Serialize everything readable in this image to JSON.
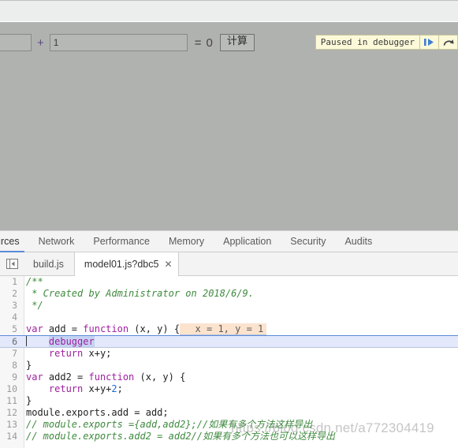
{
  "page": {
    "calculator": {
      "input_a_value": "",
      "input_b_value": "1",
      "plus_label": "+",
      "equals_label": "=",
      "result_value": "0",
      "calc_button_label": "计算"
    },
    "debugger_banner": {
      "message": "Paused in debugger",
      "resume_icon": "resume-script-execution-icon",
      "step_over_icon": "step-over-next-function-call-icon"
    }
  },
  "devtools": {
    "panel_tabs": [
      {
        "label": "urces",
        "active": true
      },
      {
        "label": "Network",
        "active": false
      },
      {
        "label": "Performance",
        "active": false
      },
      {
        "label": "Memory",
        "active": false
      },
      {
        "label": "Application",
        "active": false
      },
      {
        "label": "Security",
        "active": false
      },
      {
        "label": "Audits",
        "active": false
      }
    ],
    "navigator_toggle_icon": "show-navigator-panel-icon",
    "file_tabs": [
      {
        "label": "build.js",
        "active": false,
        "closable": false
      },
      {
        "label": "model01.js?dbc5",
        "active": true,
        "closable": true,
        "close_label": "✕"
      }
    ],
    "editor": {
      "inline_value_hint": "x = 1, y = 1",
      "lines": [
        {
          "n": "1",
          "tokens": [
            {
              "t": "/**",
              "c": "cmt"
            }
          ]
        },
        {
          "n": "2",
          "tokens": [
            {
              "t": " * Created by Administrator on 2018/6/9.",
              "c": "cmt"
            }
          ]
        },
        {
          "n": "3",
          "tokens": [
            {
              "t": " */",
              "c": "cmt"
            }
          ]
        },
        {
          "n": "4",
          "tokens": []
        },
        {
          "n": "5",
          "tokens": [
            {
              "t": "var",
              "c": "kw"
            },
            {
              "t": " add = ",
              "c": "op"
            },
            {
              "t": "function",
              "c": "kw"
            },
            {
              "t": " (x, y) {",
              "c": "op"
            }
          ],
          "hint": true
        },
        {
          "n": "6",
          "tokens": [
            {
              "t": "    ",
              "c": "op"
            },
            {
              "t": "debugger",
              "c": "kw",
              "sel": true
            }
          ],
          "exec": true,
          "caret": true
        },
        {
          "n": "7",
          "tokens": [
            {
              "t": "    ",
              "c": "op"
            },
            {
              "t": "return",
              "c": "kw"
            },
            {
              "t": " x+y;",
              "c": "op"
            }
          ]
        },
        {
          "n": "8",
          "tokens": [
            {
              "t": "}",
              "c": "op"
            }
          ]
        },
        {
          "n": "9",
          "tokens": [
            {
              "t": "var",
              "c": "kw"
            },
            {
              "t": " add2 = ",
              "c": "op"
            },
            {
              "t": "function",
              "c": "kw"
            },
            {
              "t": " (x, y) {",
              "c": "op"
            }
          ]
        },
        {
          "n": "10",
          "tokens": [
            {
              "t": "    ",
              "c": "op"
            },
            {
              "t": "return",
              "c": "kw"
            },
            {
              "t": " x+y+",
              "c": "op"
            },
            {
              "t": "2",
              "c": "num"
            },
            {
              "t": ";",
              "c": "op"
            }
          ]
        },
        {
          "n": "11",
          "tokens": [
            {
              "t": "}",
              "c": "op"
            }
          ]
        },
        {
          "n": "12",
          "tokens": [
            {
              "t": "module.exports.add = add;",
              "c": "op"
            }
          ]
        },
        {
          "n": "13",
          "tokens": [
            {
              "t": "// module.exports ={add,add2};//如果有多个方法这样导出",
              "c": "cmt"
            }
          ]
        },
        {
          "n": "14",
          "tokens": [
            {
              "t": "// module.exports.add2 = add2//如果有多个方法也可以这样导出",
              "c": "cmt"
            }
          ]
        }
      ]
    }
  },
  "watermark": {
    "text": "https://blog.csdn.net/a772304419"
  },
  "colors": {
    "accent_blue": "#5b8bd9",
    "exec_line_bg": "#e3e8fb",
    "value_hint_bg": "#fbe3ce",
    "paused_banner_bg": "#fcf9d9",
    "page_overlay_grey": "#b0b2b0",
    "comment_green": "#3f8a3f",
    "keyword_purple": "#a020a0"
  }
}
